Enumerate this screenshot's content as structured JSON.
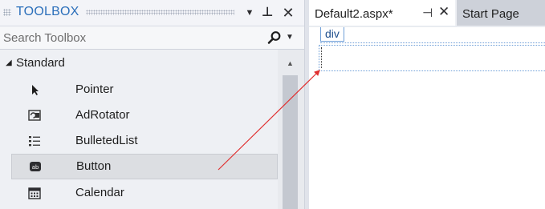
{
  "toolbox": {
    "title": "TOOLBOX",
    "search_placeholder": "Search Toolbox",
    "group": {
      "label": "Standard",
      "expanded": true
    },
    "items": [
      {
        "label": "Pointer",
        "icon": "pointer-icon"
      },
      {
        "label": "AdRotator",
        "icon": "adrotator-icon"
      },
      {
        "label": "BulletedList",
        "icon": "bulleted-list-icon"
      },
      {
        "label": "Button",
        "icon": "button-icon",
        "selected": true
      },
      {
        "label": "Calendar",
        "icon": "calendar-icon"
      }
    ]
  },
  "document_tabs": [
    {
      "label": "Default2.aspx*",
      "active": true
    },
    {
      "label": "Start Page",
      "active": false
    }
  ],
  "design": {
    "element_tag": "div"
  },
  "colors": {
    "accent": "#2b6fba",
    "drag_arrow": "#e03030",
    "selected_item_bg": "#dcdee2"
  }
}
